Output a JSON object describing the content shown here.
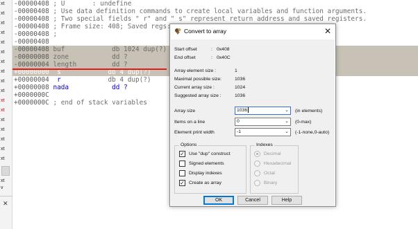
{
  "gutter": {
    "items": [
      "xt",
      "xt",
      "xt",
      "xt",
      "xt",
      "xt",
      "xt",
      "xt",
      "xt",
      "xt",
      "xt",
      "xt",
      "xt",
      "xt",
      "xt",
      "xt",
      "xt",
      "xt",
      "xt",
      "xt",
      "xt"
    ],
    "red_items": [
      "xt",
      "xt",
      "xt"
    ],
    "bottom_items": [
      "xt",
      "v"
    ],
    "close_label": "✕"
  },
  "code": {
    "lines": [
      {
        "addr": "-00000408",
        "rest": " ; U       : undefine"
      },
      {
        "addr": "-00000408",
        "rest": " ; Use data definition commands to create local variables and function arguments."
      },
      {
        "addr": "-00000408",
        "rest": " ; Two special fields \" r\" and \" s\" represent return address and saved registers."
      },
      {
        "addr": "-00000408",
        "rest": " ; Frame size: 408; Saved regs: 4"
      },
      {
        "addr": "-00000408",
        "rest": " ;"
      },
      {
        "addr": "-00000408",
        "rest": ""
      },
      {
        "addr": "-00000408",
        "name": " buf",
        "def": "            db 1024 dup(?)"
      },
      {
        "addr": "-00000008",
        "name": " zone",
        "def": "           dd ?"
      },
      {
        "addr": "-00000004",
        "name": " length",
        "def": "         dd ?"
      },
      {
        "addr": "+00000000",
        "name": "  s",
        "def": "            db 4 dup(?)"
      },
      {
        "addr": "+00000004",
        "name": "  r",
        "def": "            db 4 dup(?)"
      },
      {
        "addr": "+00000008",
        "name": " nada",
        "def": "           dd ?"
      },
      {
        "addr": "+0000000C",
        "rest": ""
      },
      {
        "addr": "+0000000C",
        "rest": " ; end of stack variables"
      }
    ]
  },
  "dialog": {
    "title": "Convert to array",
    "close_label": "✕",
    "start_offset_label": "Start offset",
    "start_offset_sep": ":",
    "start_offset_value": "0x408",
    "end_offset_label": "End offset",
    "end_offset_sep": ":",
    "end_offset_value": "0x40C",
    "elem_size_label": "Array element size :",
    "elem_size_value": "1",
    "max_size_label": "Maximal possible size:",
    "max_size_value": "1036",
    "cur_size_label": "Current array size :",
    "cur_size_value": "1024",
    "sugg_size_label": "Suggested array size :",
    "sugg_size_value": "1036",
    "array_size_label": "Array size",
    "array_size_value": "1036",
    "array_size_hint": "(in elements)",
    "items_line_label": "Items on a line",
    "items_line_value": "0",
    "items_line_hint": "(0-max)",
    "print_width_label": "Element print width",
    "print_width_value": "-1",
    "print_width_hint": "(-1-none,0-auto)",
    "options_title": "Options",
    "options": [
      {
        "label": "Use \"dup\" construct",
        "checked": true
      },
      {
        "label": "Signed elements",
        "checked": false
      },
      {
        "label": "Display indexes",
        "checked": false
      },
      {
        "label": "Create as array",
        "checked": true
      }
    ],
    "indexes_title": "Indexes",
    "indexes": [
      {
        "label": "Decimal",
        "selected": true
      },
      {
        "label": "Hexadecimal",
        "selected": false
      },
      {
        "label": "Octal",
        "selected": false
      },
      {
        "label": "Binary",
        "selected": false
      }
    ],
    "ok_label": "OK",
    "cancel_label": "Cancel",
    "help_label": "Help",
    "check_mark": "✓",
    "dropdown_arrow": "⌄"
  },
  "colors": {
    "highlight": "#c8c2b6",
    "name_blue": "#0000c8",
    "red_underline": "#e01818",
    "default_button_border": "#0078d7"
  }
}
